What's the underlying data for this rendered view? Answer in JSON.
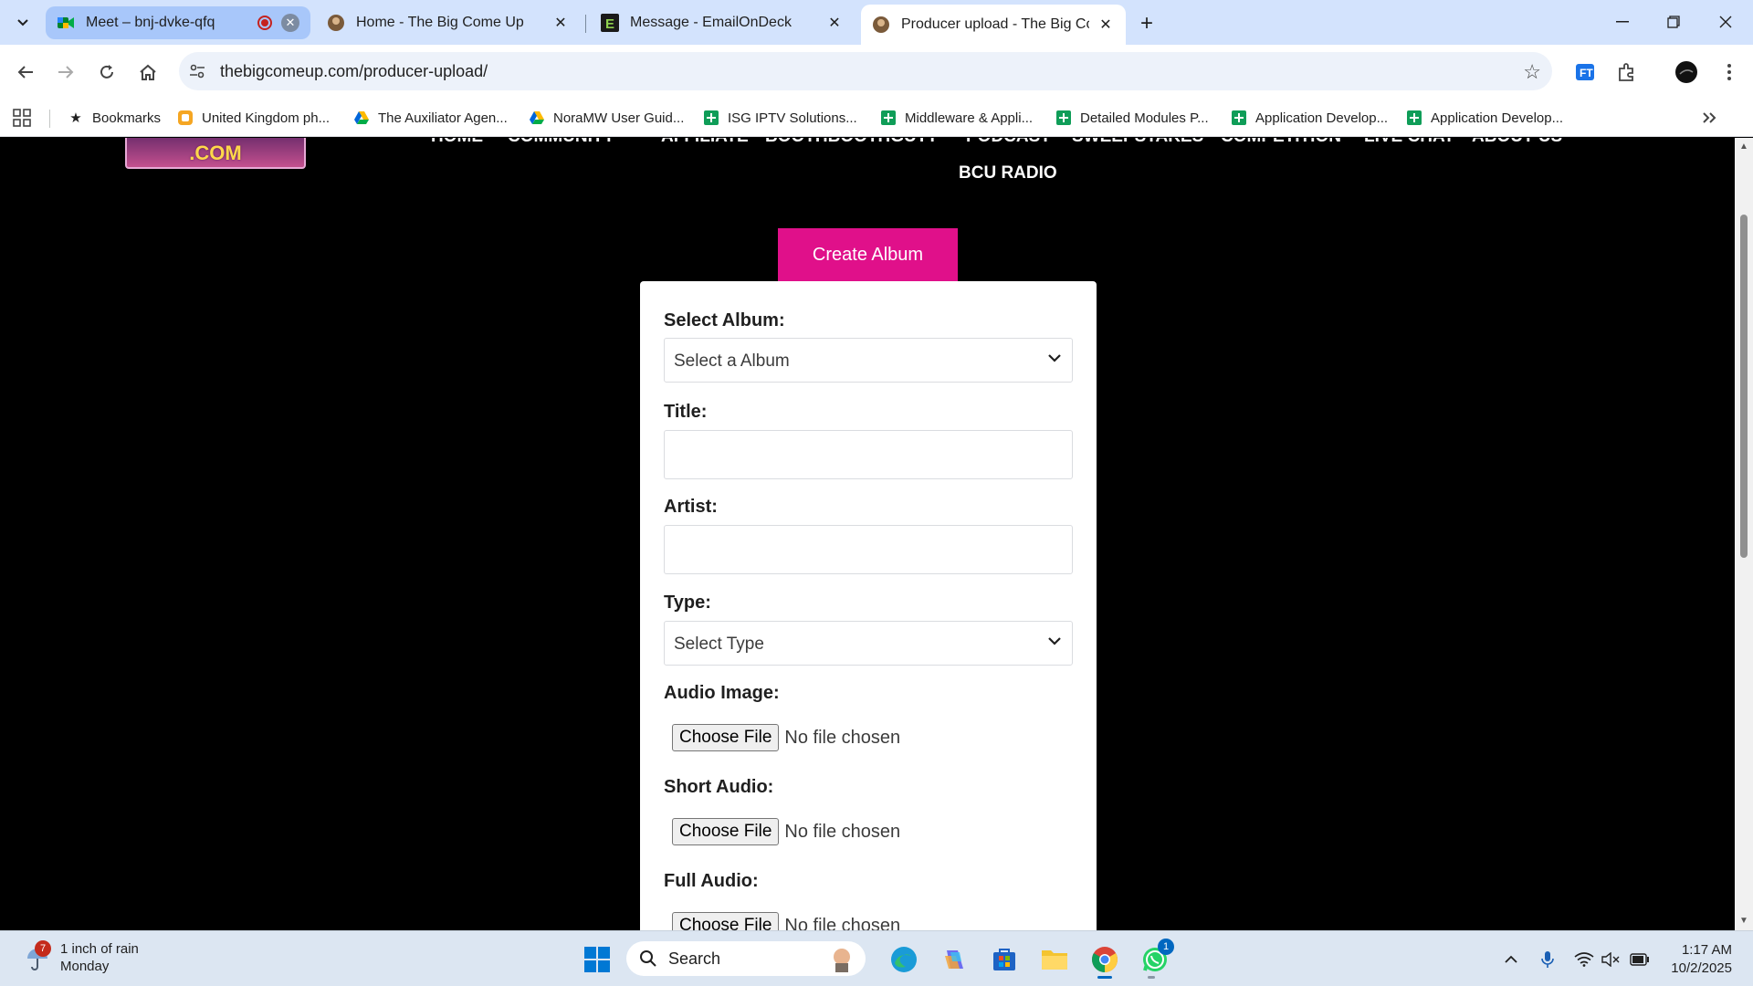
{
  "browser": {
    "tabs": [
      {
        "title": "Meet – bnj-dvke-qfq",
        "grouped": true,
        "recording": true
      },
      {
        "title": "Home - The Big Come Up"
      },
      {
        "title": "Message - EmailOnDeck"
      },
      {
        "title": "Producer upload - The Big Come Up",
        "active": true
      }
    ],
    "url": "thebigcomeup.com/producer-upload/",
    "bookmarks": [
      "Bookmarks",
      "United Kingdom ph...",
      "The Auxiliator Agen...",
      "NoraMW User Guid...",
      "ISG IPTV Solutions...",
      "Middleware & Appli...",
      "Detailed Modules P...",
      "Application Develop...",
      "Application Develop..."
    ]
  },
  "site": {
    "logo_text": ".COM",
    "nav": [
      "HOME",
      "COMMUNITY",
      "AFFILIATE",
      "BOOTHBOOTHGUTT",
      "PODCAST",
      "SWEEPSTAKES",
      "COMPETITION",
      "LIVE CHAT",
      "ABOUT US"
    ],
    "nav_second_row": "BCU RADIO"
  },
  "upload": {
    "create_album_label": "Create Album",
    "select_album_label": "Select Album:",
    "select_album_value": "Select a Album",
    "title_label": "Title:",
    "artist_label": "Artist:",
    "type_label": "Type:",
    "type_value": "Select Type",
    "audio_image_label": "Audio Image:",
    "short_audio_label": "Short Audio:",
    "full_audio_label": "Full Audio:",
    "choose_file_label": "Choose File",
    "no_file_label": "No file chosen"
  },
  "taskbar": {
    "weather_line1": "1 inch of rain",
    "weather_line2": "Monday",
    "weather_badge": "7",
    "search_label": "Search",
    "whatsapp_badge": "1",
    "time": "1:17 AM",
    "date": "10/2/2025"
  },
  "colors": {
    "accent": "#e0108a",
    "tabstrip": "#d3e3fd",
    "page_bg": "#000000"
  }
}
